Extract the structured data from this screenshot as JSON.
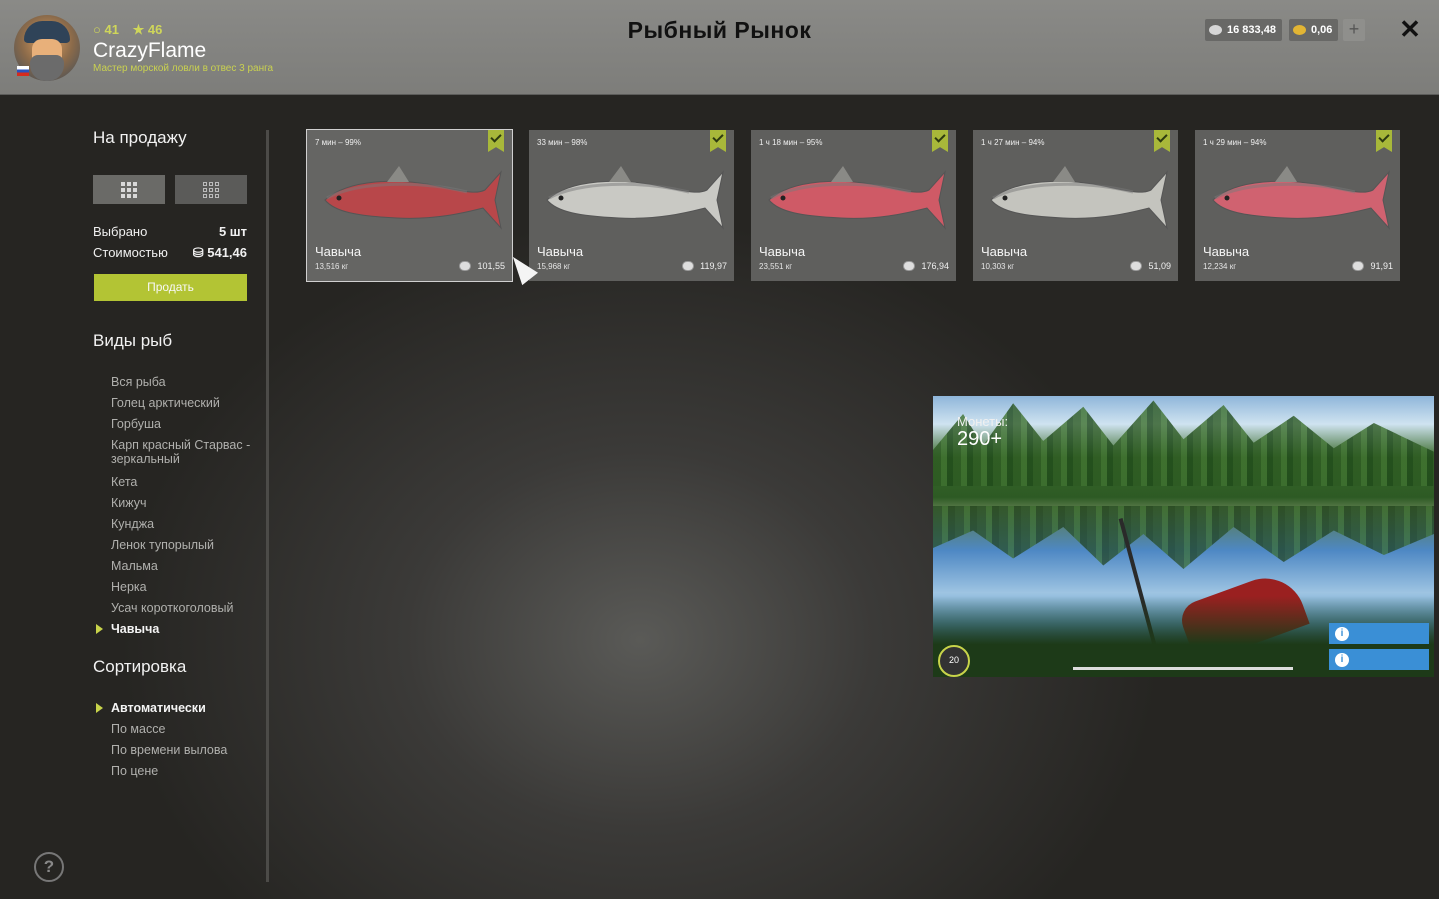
{
  "header": {
    "title": "Рыбный Рынок",
    "player": {
      "stat_a": "41",
      "stat_b": "46",
      "name": "CrazyFlame",
      "rank": "Мастер морской ловли в отвес 3 ранга"
    },
    "silver": "16 833,48",
    "gold": "0,06",
    "plus_label": "+",
    "close_label": "✕"
  },
  "sale": {
    "title": "На продажу",
    "selected_label": "Выбрано",
    "selected_value": "5 шт",
    "cost_label": "Стоимостью",
    "cost_value": "541,46",
    "sell_label": "Продать"
  },
  "species": {
    "title": "Виды рыб",
    "items": [
      "Вся рыба",
      "Голец арктический",
      "Горбуша",
      "Карп красный Старвас - зеркальный",
      "Кета",
      "Кижуч",
      "Кунджа",
      "Ленок тупорылый",
      "Мальма",
      "Нерка",
      "Усач короткоголовый",
      "Чавыча"
    ],
    "selected": "Чавыча"
  },
  "sort": {
    "title": "Сортировка",
    "items": [
      "Автоматически",
      "По массе",
      "По времени вылова",
      "По цене"
    ],
    "selected": "Автоматически"
  },
  "cards": [
    {
      "time": "7 мин – 99%",
      "name": "Чавыча",
      "weight": "13,516 кг",
      "price": "101,55",
      "color": "#b8474a"
    },
    {
      "time": "33 мин – 98%",
      "name": "Чавыча",
      "weight": "15,968 кг",
      "price": "119,97",
      "color": "#c9c9c4"
    },
    {
      "time": "1 ч 18 мин – 95%",
      "name": "Чавыча",
      "weight": "23,551 кг",
      "price": "176,94",
      "color": "#cf5a66"
    },
    {
      "time": "1 ч 27 мин – 94%",
      "name": "Чавыча",
      "weight": "10,303 кг",
      "price": "51,09",
      "color": "#c4c4be"
    },
    {
      "time": "1 ч 29 мин – 94%",
      "name": "Чавыча",
      "weight": "12,234 кг",
      "price": "91,91",
      "color": "#d06270"
    }
  ],
  "video": {
    "coins_label": "Монеты:",
    "coins_value": "290+",
    "level": "20"
  },
  "help_label": "?"
}
